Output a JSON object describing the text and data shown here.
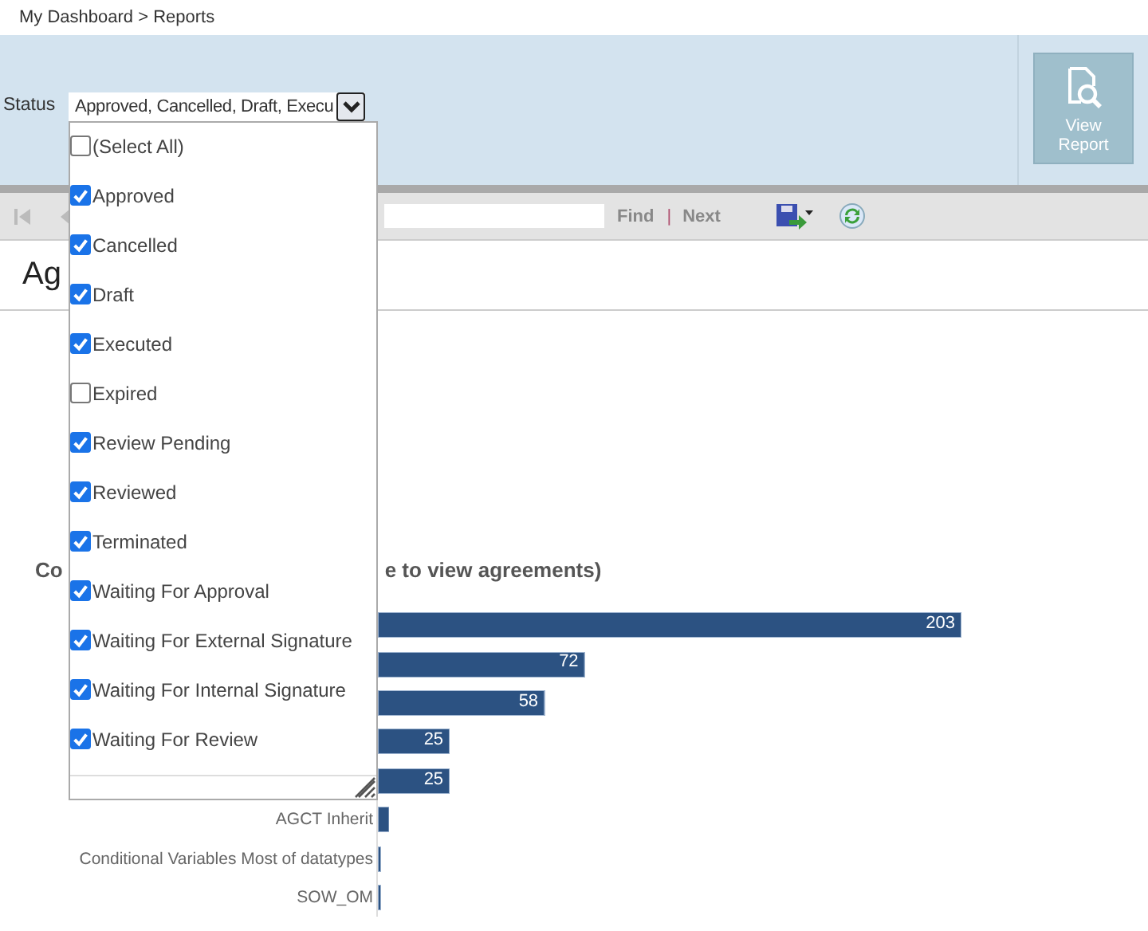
{
  "breadcrumb": "My Dashboard > Reports",
  "parameters": {
    "label": "Status",
    "value": "Approved, Cancelled, Draft, Execu",
    "expanded": true,
    "options": [
      {
        "label": "(Select All)",
        "checked": false
      },
      {
        "label": "Approved",
        "checked": true
      },
      {
        "label": "Cancelled",
        "checked": true
      },
      {
        "label": "Draft",
        "checked": true
      },
      {
        "label": "Executed",
        "checked": true
      },
      {
        "label": "Expired",
        "checked": false
      },
      {
        "label": "Review Pending",
        "checked": true
      },
      {
        "label": "Reviewed",
        "checked": true
      },
      {
        "label": "Terminated",
        "checked": true
      },
      {
        "label": "Waiting For Approval",
        "checked": true
      },
      {
        "label": "Waiting For External Signature",
        "checked": true
      },
      {
        "label": "Waiting For Internal Signature",
        "checked": true
      },
      {
        "label": "Waiting For Review",
        "checked": true
      }
    ]
  },
  "view_report_button": {
    "label": "View Report",
    "disabled": true
  },
  "toolbar": {
    "find": "Find",
    "separator": "|",
    "next": "Next"
  },
  "report_title": "Ag",
  "chart_title": {
    "start": "Co",
    "end": "e to view agreements)"
  },
  "chart_data": {
    "type": "bar",
    "orientation": "horizontal",
    "categories": [
      null,
      null,
      null,
      null,
      null,
      "AGCT Inherit",
      "Conditional Variables Most of datatypes",
      "SOW_OM"
    ],
    "values": [
      203,
      72,
      58,
      25,
      25,
      4,
      1,
      0.5
    ],
    "value_labels": [
      "203",
      "72",
      "58",
      "25",
      "25",
      null,
      null,
      null
    ]
  }
}
